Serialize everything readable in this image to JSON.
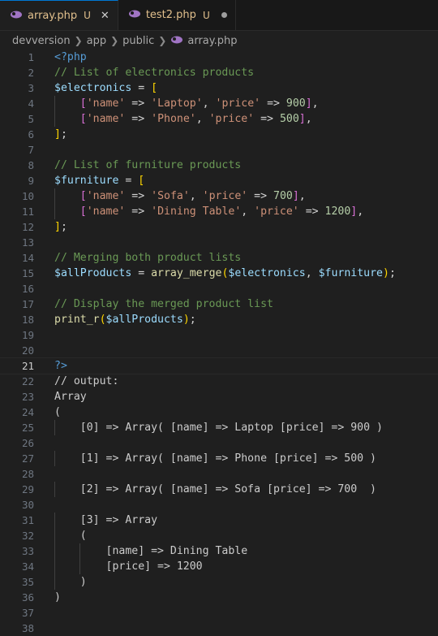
{
  "tabs": [
    {
      "name": "array.php",
      "flag": "U",
      "active": true
    },
    {
      "name": "test2.php",
      "flag": "U",
      "active": false
    }
  ],
  "breadcrumb": [
    "devversion",
    "app",
    "public",
    "array.php"
  ],
  "editor": {
    "current_line": 21,
    "lines": [
      {
        "n": "1",
        "segments": [
          {
            "t": "<?php",
            "c": "kw"
          }
        ]
      },
      {
        "n": "2",
        "segments": [
          {
            "t": "// List of electronics products",
            "c": "cm"
          }
        ]
      },
      {
        "n": "3",
        "segments": [
          {
            "t": "$electronics",
            "c": "var"
          },
          {
            "t": " = ",
            "c": "op"
          },
          {
            "t": "[",
            "c": "br1"
          }
        ]
      },
      {
        "n": "4",
        "segments": [
          {
            "t": "    ",
            "c": "op"
          },
          {
            "t": "[",
            "c": "br2"
          },
          {
            "t": "'name'",
            "c": "str"
          },
          {
            "t": " => ",
            "c": "op"
          },
          {
            "t": "'Laptop'",
            "c": "str"
          },
          {
            "t": ", ",
            "c": "op"
          },
          {
            "t": "'price'",
            "c": "str"
          },
          {
            "t": " => ",
            "c": "op"
          },
          {
            "t": "900",
            "c": "num"
          },
          {
            "t": "]",
            "c": "br2"
          },
          {
            "t": ",",
            "c": "op"
          }
        ]
      },
      {
        "n": "5",
        "segments": [
          {
            "t": "    ",
            "c": "op"
          },
          {
            "t": "[",
            "c": "br2"
          },
          {
            "t": "'name'",
            "c": "str"
          },
          {
            "t": " => ",
            "c": "op"
          },
          {
            "t": "'Phone'",
            "c": "str"
          },
          {
            "t": ", ",
            "c": "op"
          },
          {
            "t": "'price'",
            "c": "str"
          },
          {
            "t": " => ",
            "c": "op"
          },
          {
            "t": "500",
            "c": "num"
          },
          {
            "t": "]",
            "c": "br2"
          },
          {
            "t": ",",
            "c": "op"
          }
        ]
      },
      {
        "n": "6",
        "segments": [
          {
            "t": "]",
            "c": "br1"
          },
          {
            "t": ";",
            "c": "op"
          }
        ]
      },
      {
        "n": "7",
        "segments": []
      },
      {
        "n": "8",
        "segments": [
          {
            "t": "// List of furniture products",
            "c": "cm"
          }
        ]
      },
      {
        "n": "9",
        "segments": [
          {
            "t": "$furniture",
            "c": "var"
          },
          {
            "t": " = ",
            "c": "op"
          },
          {
            "t": "[",
            "c": "br1"
          }
        ]
      },
      {
        "n": "10",
        "segments": [
          {
            "t": "    ",
            "c": "op"
          },
          {
            "t": "[",
            "c": "br2"
          },
          {
            "t": "'name'",
            "c": "str"
          },
          {
            "t": " => ",
            "c": "op"
          },
          {
            "t": "'Sofa'",
            "c": "str"
          },
          {
            "t": ", ",
            "c": "op"
          },
          {
            "t": "'price'",
            "c": "str"
          },
          {
            "t": " => ",
            "c": "op"
          },
          {
            "t": "700",
            "c": "num"
          },
          {
            "t": "]",
            "c": "br2"
          },
          {
            "t": ",",
            "c": "op"
          }
        ]
      },
      {
        "n": "11",
        "segments": [
          {
            "t": "    ",
            "c": "op"
          },
          {
            "t": "[",
            "c": "br2"
          },
          {
            "t": "'name'",
            "c": "str"
          },
          {
            "t": " => ",
            "c": "op"
          },
          {
            "t": "'Dining Table'",
            "c": "str"
          },
          {
            "t": ", ",
            "c": "op"
          },
          {
            "t": "'price'",
            "c": "str"
          },
          {
            "t": " => ",
            "c": "op"
          },
          {
            "t": "1200",
            "c": "num"
          },
          {
            "t": "]",
            "c": "br2"
          },
          {
            "t": ",",
            "c": "op"
          }
        ]
      },
      {
        "n": "12",
        "segments": [
          {
            "t": "]",
            "c": "br1"
          },
          {
            "t": ";",
            "c": "op"
          }
        ]
      },
      {
        "n": "13",
        "segments": []
      },
      {
        "n": "14",
        "segments": [
          {
            "t": "// Merging both product lists",
            "c": "cm"
          }
        ]
      },
      {
        "n": "15",
        "segments": [
          {
            "t": "$allProducts",
            "c": "var"
          },
          {
            "t": " = ",
            "c": "op"
          },
          {
            "t": "array_merge",
            "c": "fn"
          },
          {
            "t": "(",
            "c": "br1"
          },
          {
            "t": "$electronics",
            "c": "var"
          },
          {
            "t": ", ",
            "c": "op"
          },
          {
            "t": "$furniture",
            "c": "var"
          },
          {
            "t": ")",
            "c": "br1"
          },
          {
            "t": ";",
            "c": "op"
          }
        ]
      },
      {
        "n": "16",
        "segments": []
      },
      {
        "n": "17",
        "segments": [
          {
            "t": "// Display the merged product list",
            "c": "cm"
          }
        ]
      },
      {
        "n": "18",
        "segments": [
          {
            "t": "print_r",
            "c": "fn"
          },
          {
            "t": "(",
            "c": "br1"
          },
          {
            "t": "$allProducts",
            "c": "var"
          },
          {
            "t": ")",
            "c": "br1"
          },
          {
            "t": ";",
            "c": "op"
          }
        ]
      },
      {
        "n": "19",
        "segments": []
      },
      {
        "n": "20",
        "segments": []
      },
      {
        "n": "21",
        "segments": [
          {
            "t": "?>",
            "c": "kw"
          }
        ]
      },
      {
        "n": "22",
        "segments": [
          {
            "t": "// output:",
            "c": "pl"
          }
        ]
      },
      {
        "n": "23",
        "segments": [
          {
            "t": "Array",
            "c": "pl"
          }
        ]
      },
      {
        "n": "24",
        "segments": [
          {
            "t": "(",
            "c": "pl"
          }
        ]
      },
      {
        "n": "25",
        "segments": [
          {
            "t": "    [0] => Array( [name] => Laptop [price] => 900 )",
            "c": "pl"
          }
        ]
      },
      {
        "n": "26",
        "segments": []
      },
      {
        "n": "27",
        "segments": [
          {
            "t": "    [1] => Array( [name] => Phone [price] => 500 )",
            "c": "pl"
          }
        ]
      },
      {
        "n": "28",
        "segments": []
      },
      {
        "n": "29",
        "segments": [
          {
            "t": "    [2] => Array( [name] => Sofa [price] => 700  )",
            "c": "pl"
          }
        ]
      },
      {
        "n": "30",
        "segments": []
      },
      {
        "n": "31",
        "segments": [
          {
            "t": "    [3] => Array",
            "c": "pl"
          }
        ]
      },
      {
        "n": "32",
        "segments": [
          {
            "t": "    (",
            "c": "pl"
          }
        ]
      },
      {
        "n": "33",
        "segments": [
          {
            "t": "        [name] => Dining Table",
            "c": "pl"
          }
        ]
      },
      {
        "n": "34",
        "segments": [
          {
            "t": "        [price] => 1200",
            "c": "pl"
          }
        ]
      },
      {
        "n": "35",
        "segments": [
          {
            "t": "    )",
            "c": "pl"
          }
        ]
      },
      {
        "n": "36",
        "segments": [
          {
            "t": ")",
            "c": "pl"
          }
        ]
      },
      {
        "n": "37",
        "segments": []
      },
      {
        "n": "38",
        "segments": []
      }
    ]
  }
}
